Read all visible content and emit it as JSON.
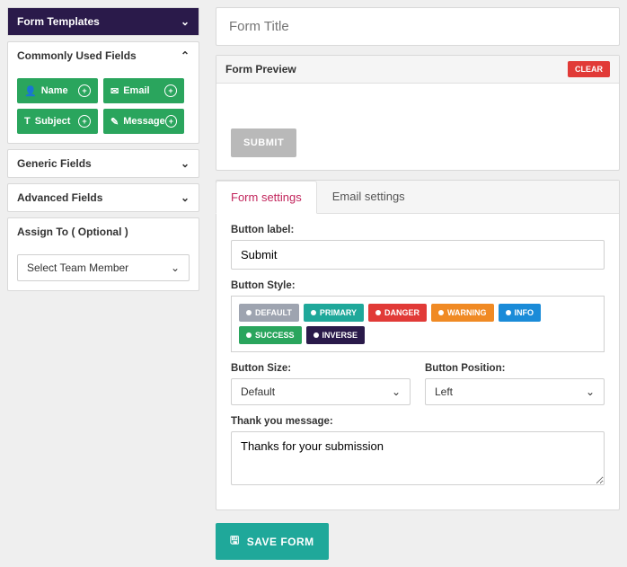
{
  "sidebar": {
    "templates": {
      "label": "Form Templates"
    },
    "common": {
      "label": "Commonly Used Fields",
      "fields": [
        {
          "name": "Name",
          "icon": "👤"
        },
        {
          "name": "Email",
          "icon": "✉"
        },
        {
          "name": "Subject",
          "icon": "T"
        },
        {
          "name": "Message",
          "icon": "✎"
        }
      ]
    },
    "generic": {
      "label": "Generic Fields"
    },
    "advanced": {
      "label": "Advanced Fields"
    },
    "assign": {
      "label": "Assign To ( Optional )",
      "selected": "Select Team Member"
    }
  },
  "titleInput": {
    "placeholder": "Form Title"
  },
  "preview": {
    "label": "Form Preview",
    "clear": "CLEAR",
    "submit": "SUBMIT"
  },
  "tabs": {
    "form": "Form settings",
    "email": "Email settings"
  },
  "settings": {
    "buttonLabel": {
      "label": "Button label:",
      "value": "Submit"
    },
    "buttonStyle": {
      "label": "Button Style:",
      "options": [
        {
          "text": "DEFAULT",
          "bg": "#9ea4b0"
        },
        {
          "text": "PRIMARY",
          "bg": "#1fa89a"
        },
        {
          "text": "DANGER",
          "bg": "#e13a37"
        },
        {
          "text": "WARNING",
          "bg": "#f08a24"
        },
        {
          "text": "INFO",
          "bg": "#1a8bd8"
        },
        {
          "text": "SUCCESS",
          "bg": "#2aa55d"
        },
        {
          "text": "INVERSE",
          "bg": "#2a1a4a"
        }
      ]
    },
    "buttonSize": {
      "label": "Button Size:",
      "value": "Default"
    },
    "buttonPos": {
      "label": "Button Position:",
      "value": "Left"
    },
    "thanks": {
      "label": "Thank you message:",
      "value": "Thanks for your submission"
    }
  },
  "save": "SAVE FORM"
}
